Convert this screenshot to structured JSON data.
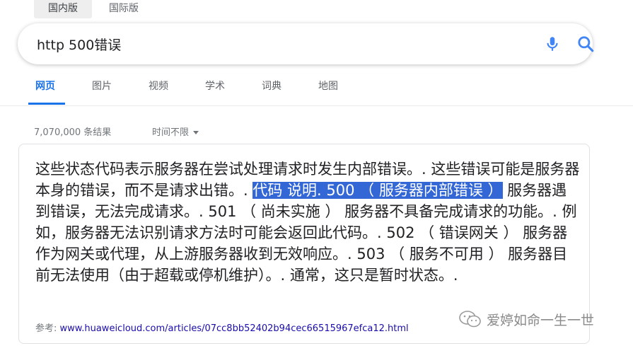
{
  "region_tabs": [
    {
      "label": "国内版",
      "active": true
    },
    {
      "label": "国际版",
      "active": false
    }
  ],
  "search": {
    "value": "http 500错误",
    "placeholder": ""
  },
  "icons": {
    "mic": "microphone-icon",
    "search": "search-icon",
    "caret": "caret-down-icon"
  },
  "nav": {
    "tabs": [
      {
        "label": "网页",
        "active": true
      },
      {
        "label": "图片",
        "active": false
      },
      {
        "label": "视频",
        "active": false
      },
      {
        "label": "学术",
        "active": false
      },
      {
        "label": "词典",
        "active": false
      },
      {
        "label": "地图",
        "active": false
      }
    ]
  },
  "results": {
    "count": "7,070,000 条结果",
    "time_filter": "时间不限"
  },
  "snippet": {
    "before": "这些状态代码表示服务器在尝试处理请求时发生内部错误。. 这些错误可能是服务器本身的错误，而不是请求出错。. ",
    "highlight": "代码 说明. 500 （ 服务器内部错误 ）",
    "after": " 服务器遇到错误，无法完成请求。. 501 （ 尚未实施 ） 服务器不具备完成请求的功能。. 例如，服务器无法识别请求方法时可能会返回此代码。. 502 （ 错误网关 ） 服务器作为网关或代理，从上游服务器收到无效响应。. 503 （ 服务不可用 ） 服务器目前无法使用（由于超载或停机维护）。. 通常，这只是暂时状态。.",
    "ref_label": "参考:",
    "ref_url": "www.huaweicloud.com/articles/07cc8bb52402b94cec66515967efca12.html"
  },
  "watermark": {
    "text": "爱婷如命一生一世"
  },
  "colors": {
    "accent": "#1a73e8",
    "highlight": "#3367d6",
    "link": "#1a0dab"
  }
}
